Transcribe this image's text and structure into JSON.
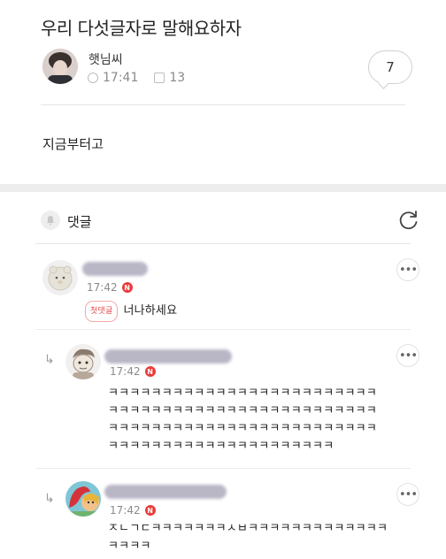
{
  "post": {
    "title": "우리 다섯글자로 말해요하자",
    "author": "햇님씨",
    "time": "17:41",
    "views": "13",
    "comment_count": "7",
    "body": "지금부터고"
  },
  "comments_section": {
    "label": "댓글"
  },
  "comments": [
    {
      "time": "17:42",
      "badge": "N",
      "first_tag": "첫댓글",
      "text": "너나하세요",
      "more": "•••"
    },
    {
      "reply_arrow": "↳",
      "time": "17:42",
      "badge": "N",
      "text_lines": [
        "ㅋㅋㅋㅋㅋㅋㅋㅋㅋㅋㅋㅋㅋㅋㅋㅋㅋㅋㅋㅋㅋㅋㅋㅋㅋ",
        "ㅋㅋㅋㅋㅋㅋㅋㅋㅋㅋㅋㅋㅋㅋㅋㅋㅋㅋㅋㅋㅋㅋㅋㅋㅋ",
        "ㅋㅋㅋㅋㅋㅋㅋㅋㅋㅋㅋㅋㅋㅋㅋㅋㅋㅋㅋㅋㅋㅋㅋㅋㅋ",
        "ㅋㅋㅋㅋㅋㅋㅋㅋㅋㅋㅋㅋㅋㅋㅋㅋㅋㅋㅋㅋㅋ"
      ],
      "more": "•••"
    },
    {
      "reply_arrow": "↳",
      "time": "17:42",
      "badge": "N",
      "text_lines": [
        "ㅈㄴㄱㄷㅋㅋㅋㅋㅋㅋㅋㅅㅂㅋㅋㅋㅋㅋㅋㅋㅋㅋㅋㅋㅋㅋ",
        "ㅋㅋㅋㅋ"
      ],
      "more": "•••"
    }
  ],
  "colors": {
    "accent_red": "#ec3b3b",
    "blur_name": "#b9b6c6",
    "divider": "#ececec"
  },
  "icons": [
    "clock-icon",
    "document-icon",
    "bell-icon",
    "refresh-icon",
    "more-icon",
    "reply-arrow-icon"
  ]
}
